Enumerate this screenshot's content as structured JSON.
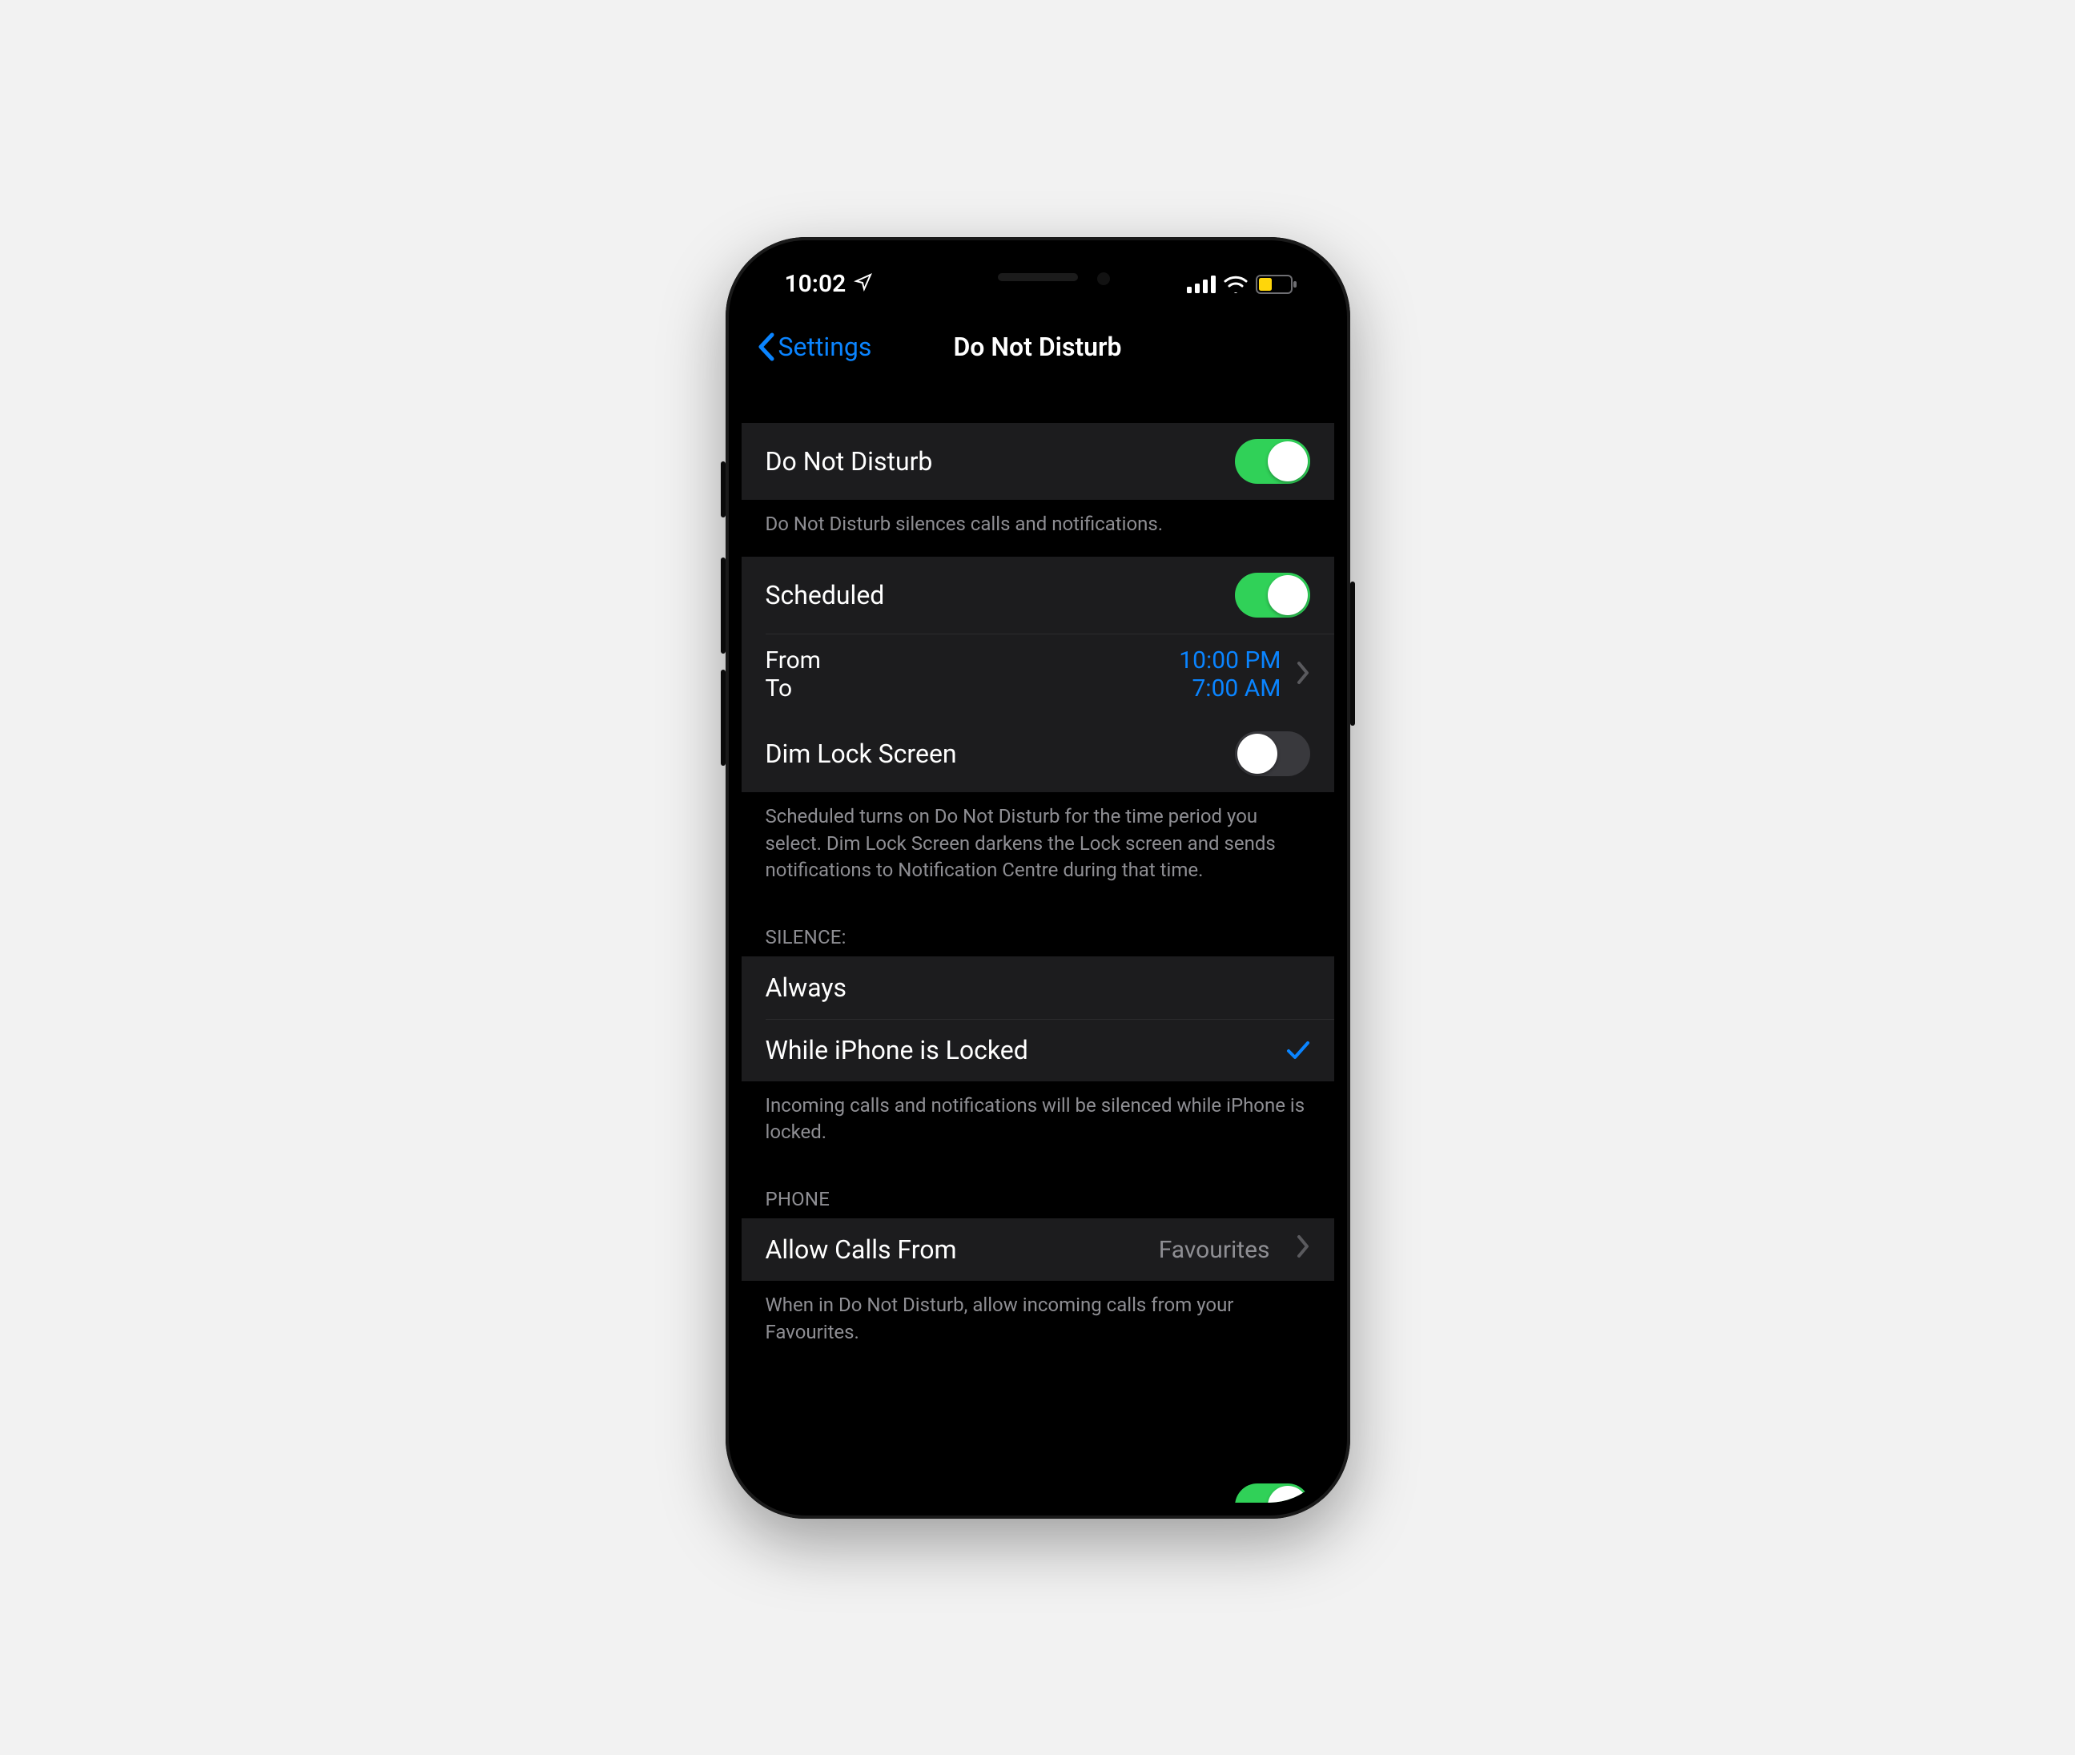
{
  "status": {
    "time": "10:02"
  },
  "nav": {
    "back_label": "Settings",
    "title": "Do Not Disturb"
  },
  "dnd": {
    "label": "Do Not Disturb",
    "footer": "Do Not Disturb silences calls and notifications."
  },
  "scheduled": {
    "label": "Scheduled",
    "from_label": "From",
    "to_label": "To",
    "from_value": "10:00 PM",
    "to_value": "7:00 AM",
    "dim_label": "Dim Lock Screen",
    "footer": "Scheduled turns on Do Not Disturb for the time period you select. Dim Lock Screen darkens the Lock screen and sends notifications to Notification Centre during that time."
  },
  "silence": {
    "header": "SILENCE:",
    "always": "Always",
    "while_locked": "While iPhone is Locked",
    "footer": "Incoming calls and notifications will be silenced while iPhone is locked."
  },
  "phone": {
    "header": "PHONE",
    "allow_label": "Allow Calls From",
    "allow_value": "Favourites",
    "footer": "When in Do Not Disturb, allow incoming calls from your Favourites."
  }
}
